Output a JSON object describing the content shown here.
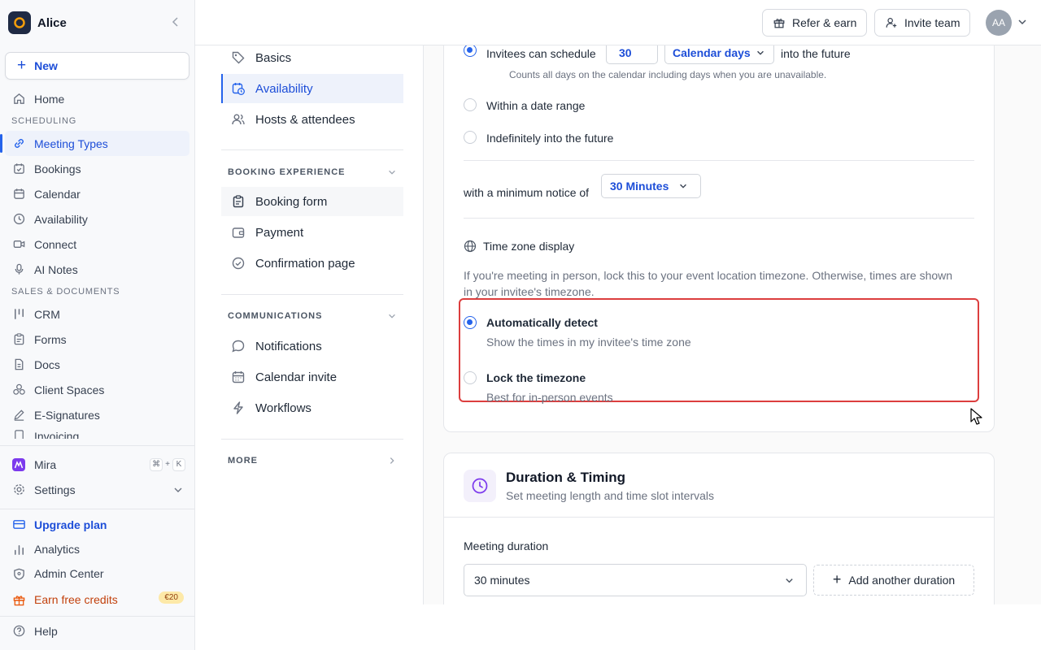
{
  "workspace": {
    "name": "Alice"
  },
  "sidebar": {
    "new_label": "New",
    "home": "Home",
    "section_scheduling": "SCHEDULING",
    "scheduling_items": [
      "Meeting Types",
      "Bookings",
      "Calendar",
      "Availability",
      "Connect",
      "AI Notes"
    ],
    "section_sales": "SALES & DOCUMENTS",
    "sales_items": [
      "CRM",
      "Forms",
      "Docs",
      "Client Spaces",
      "E-Signatures",
      "Invoicing"
    ],
    "mira": "Mira",
    "mira_shortcut": [
      "⌘",
      "+",
      "K"
    ],
    "settings": "Settings",
    "upgrade": "Upgrade plan",
    "analytics": "Analytics",
    "admin": "Admin Center",
    "earn": "Earn free credits",
    "earn_badge": "€20",
    "help": "Help"
  },
  "topbar": {
    "refer": "Refer & earn",
    "invite": "Invite team",
    "avatar_initials": "AA"
  },
  "subnav": {
    "items_top": [
      "Basics",
      "Availability",
      "Hosts & attendees"
    ],
    "section_booking": "BOOKING EXPERIENCE",
    "items_booking": [
      "Booking form",
      "Payment",
      "Confirmation page"
    ],
    "section_comms": "COMMUNICATIONS",
    "items_comms": [
      "Notifications",
      "Calendar invite",
      "Workflows"
    ],
    "section_more": "MORE"
  },
  "availability": {
    "schedule_prefix": "Invitees can schedule",
    "schedule_value": "30",
    "schedule_unit": "Calendar days",
    "schedule_suffix": "into the future",
    "schedule_hint": "Counts all days on the calendar including days when you are unavailable.",
    "option_range": "Within a date range",
    "option_indefinite": "Indefinitely into the future",
    "notice_prefix": "with a minimum notice of",
    "notice_value": "30 Minutes",
    "timezone_title": "Time zone display",
    "timezone_desc_line1": "If you're meeting in person, lock this to your event location timezone. Otherwise, times are shown",
    "timezone_desc_line2": "in your invitee's timezone.",
    "tz_auto_title": "Automatically detect",
    "tz_auto_desc": "Show the times in my invitee's time zone",
    "tz_lock_title": "Lock the timezone",
    "tz_lock_desc": "Best for in-person events"
  },
  "duration": {
    "title": "Duration & Timing",
    "subtitle": "Set meeting length and time slot intervals",
    "meeting_duration_label": "Meeting duration",
    "meeting_duration_value": "30 minutes",
    "add_duration": "Add another duration"
  },
  "colors": {
    "accent": "#2563eb",
    "highlight": "#dc3e3e",
    "purple": "#7c3aed"
  }
}
